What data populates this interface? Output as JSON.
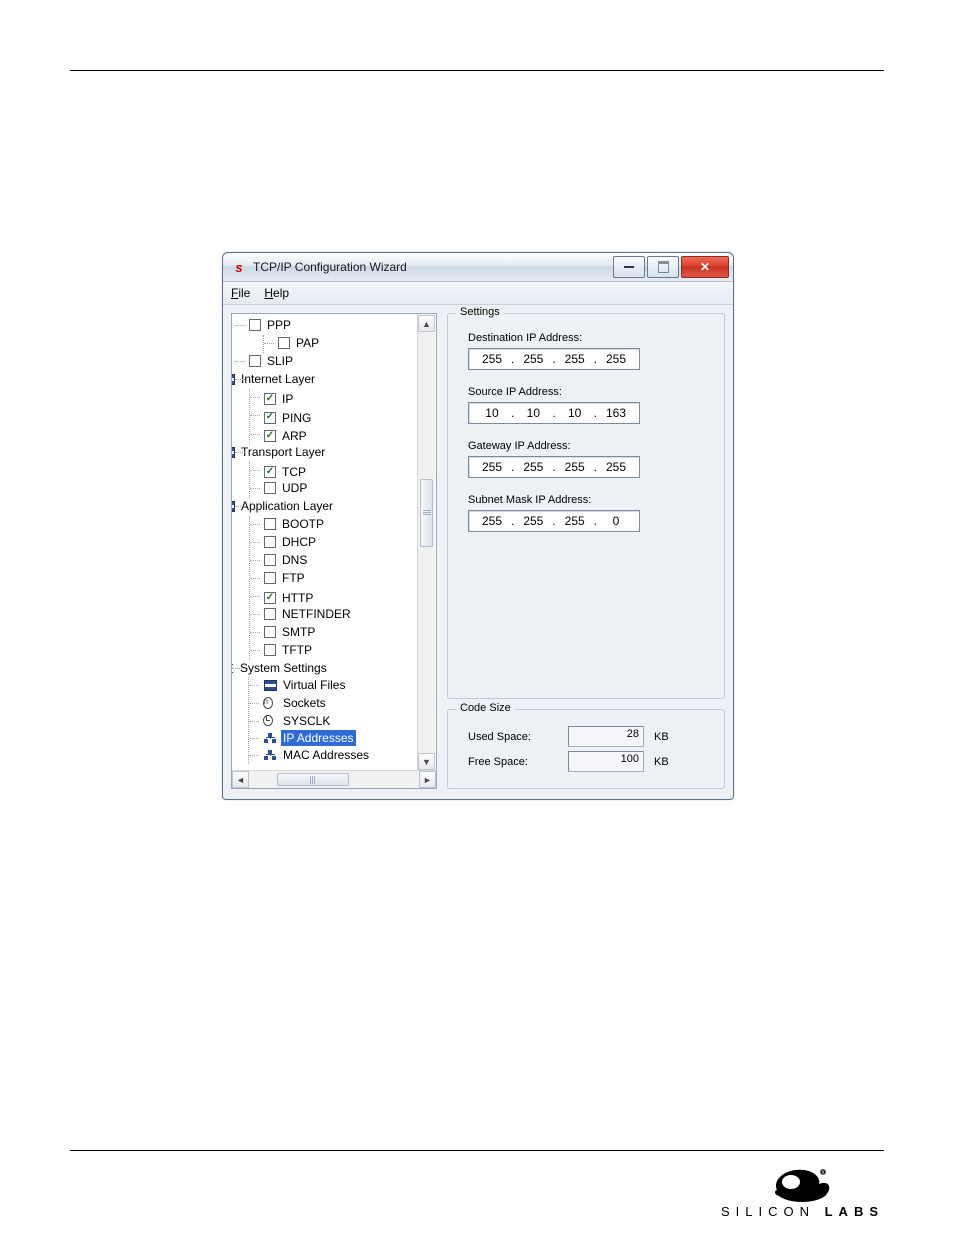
{
  "window": {
    "title": "TCP/IP Configuration Wizard"
  },
  "menu": {
    "file": "File",
    "help": "Help"
  },
  "tree": {
    "ppp": "PPP",
    "pap": "PAP",
    "slip": "SLIP",
    "internet_layer": "Internet Layer",
    "ip": "IP",
    "ping": "PING",
    "arp": "ARP",
    "transport_layer": "Transport Layer",
    "tcp": "TCP",
    "udp": "UDP",
    "application_layer": "Application Layer",
    "bootp": "BOOTP",
    "dhcp": "DHCP",
    "dns": "DNS",
    "ftp": "FTP",
    "http": "HTTP",
    "netfinder": "NETFINDER",
    "smtp": "SMTP",
    "tftp": "TFTP",
    "system_settings": "System Settings",
    "virtual_files": "Virtual Files",
    "sockets": "Sockets",
    "sysclk": "SYSCLK",
    "ip_addresses": "IP Addresses",
    "mac_addresses": "MAC Addresses"
  },
  "settings": {
    "legend": "Settings",
    "dest_label": "Destination IP Address:",
    "dest": [
      "255",
      "255",
      "255",
      "255"
    ],
    "src_label": "Source IP Address:",
    "src": [
      "10",
      "10",
      "10",
      "163"
    ],
    "gw_label": "Gateway IP Address:",
    "gw": [
      "255",
      "255",
      "255",
      "255"
    ],
    "mask_label": "Subnet Mask IP Address:",
    "mask": [
      "255",
      "255",
      "255",
      "0"
    ]
  },
  "code": {
    "legend": "Code Size",
    "used_label": "Used Space:",
    "used": "28",
    "free_label": "Free Space:",
    "free": "100",
    "unit": "KB"
  },
  "footer": {
    "brand_a": "SILICON",
    "brand_b": "LABS"
  }
}
